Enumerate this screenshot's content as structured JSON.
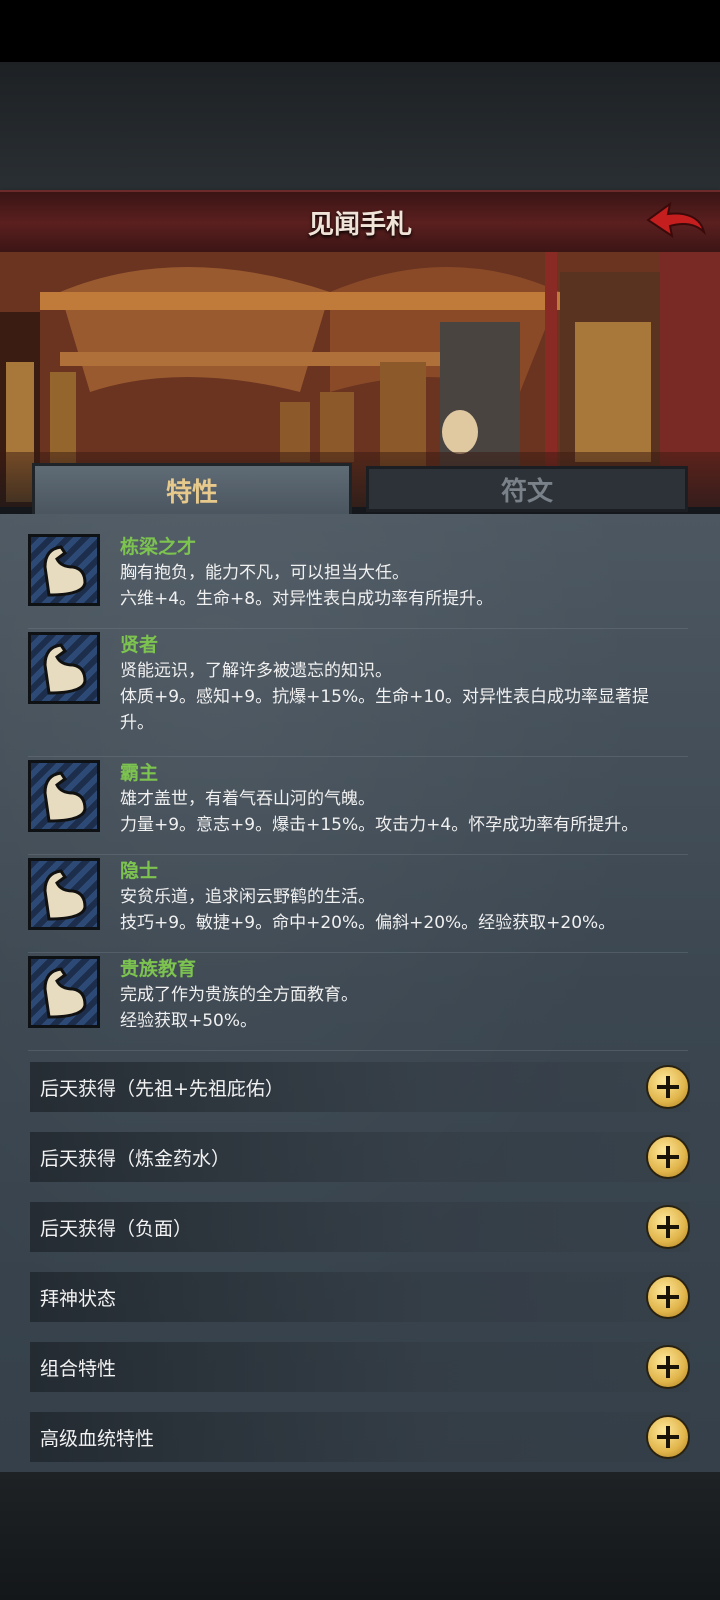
{
  "header": {
    "title": "见闻手札",
    "back_icon": "back-arrow-icon"
  },
  "tabs": [
    {
      "label": "特性",
      "active": true
    },
    {
      "label": "符文",
      "active": false
    }
  ],
  "traits": [
    {
      "name": "栋梁之才",
      "lines": [
        "胸有抱负，能力不凡，可以担当大任。",
        "六维+4。生命+8。对异性表白成功率有所提升。"
      ]
    },
    {
      "name": "贤者",
      "lines": [
        "贤能远识，了解许多被遗忘的知识。",
        "体质+9。感知+9。抗爆+15%。生命+10。对异性表白成功率显著提",
        "升。"
      ]
    },
    {
      "name": "霸主",
      "lines": [
        "雄才盖世，有着气吞山河的气魄。",
        "力量+9。意志+9。爆击+15%。攻击力+4。怀孕成功率有所提升。"
      ]
    },
    {
      "name": "隐士",
      "lines": [
        "安贫乐道，追求闲云野鹤的生活。",
        "技巧+9。敏捷+9。命中+20%。偏斜+20%。经验获取+20%。"
      ]
    },
    {
      "name": "贵族教育",
      "lines": [
        "完成了作为贵族的全方面教育。",
        "经验获取+50%。"
      ]
    }
  ],
  "sections": [
    {
      "label": "后天获得（先祖+先祖庇佑）"
    },
    {
      "label": "后天获得（炼金药水）"
    },
    {
      "label": "后天获得（负面）"
    },
    {
      "label": "拜神状态"
    },
    {
      "label": "组合特性"
    },
    {
      "label": "高级血统特性"
    }
  ],
  "colors": {
    "trait_name": "#7dc350",
    "tab_active_text": "#e7c98c",
    "header_bg": "#5b1f1f",
    "back_arrow": "#c41e1e",
    "plus_button": "#e0b44a"
  }
}
